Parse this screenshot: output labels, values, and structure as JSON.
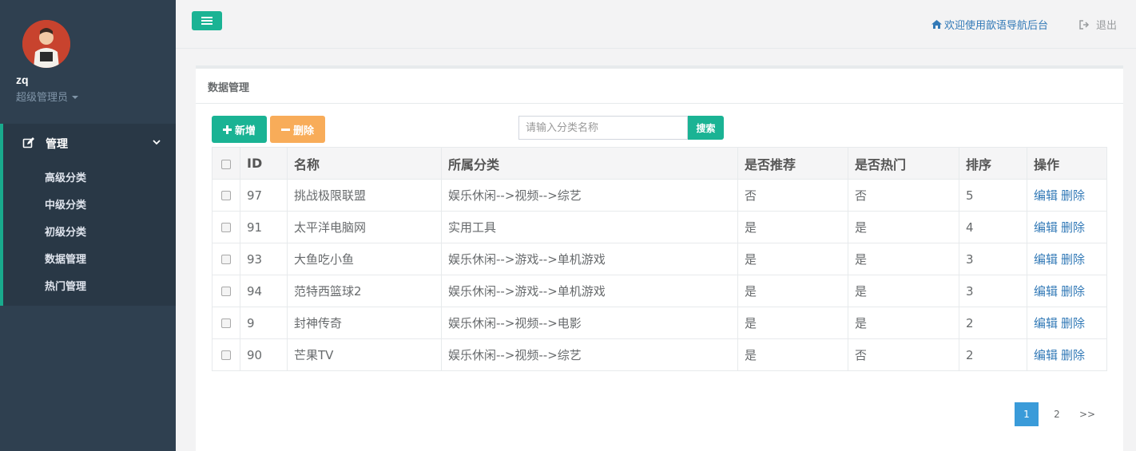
{
  "sidebar": {
    "user_name": "zq",
    "user_role": "超级管理员",
    "menu_label": "管理",
    "items": [
      "高级分类",
      "中级分类",
      "初级分类",
      "数据管理",
      "热门管理"
    ]
  },
  "header": {
    "welcome": "欢迎使用歆语导航后台",
    "logout": "退出"
  },
  "panel": {
    "title": "数据管理",
    "add_label": "新增",
    "delete_label": "删除",
    "search_placeholder": "请输入分类名称",
    "search_button": "搜索"
  },
  "table": {
    "headers": [
      "ID",
      "名称",
      "所属分类",
      "是否推荐",
      "是否热门",
      "排序",
      "操作"
    ],
    "rows": [
      {
        "id": "97",
        "name": "挑战极限联盟",
        "category": "娱乐休闲-->视频-->综艺",
        "recommend": "否",
        "hot": "否",
        "sort": "5"
      },
      {
        "id": "91",
        "name": "太平洋电脑网",
        "category": "实用工具",
        "recommend": "是",
        "hot": "是",
        "sort": "4"
      },
      {
        "id": "93",
        "name": "大鱼吃小鱼",
        "category": "娱乐休闲-->游戏-->单机游戏",
        "recommend": "是",
        "hot": "是",
        "sort": "3"
      },
      {
        "id": "94",
        "name": "范特西篮球2",
        "category": "娱乐休闲-->游戏-->单机游戏",
        "recommend": "是",
        "hot": "是",
        "sort": "3"
      },
      {
        "id": "9",
        "name": "封神传奇",
        "category": "娱乐休闲-->视频-->电影",
        "recommend": "是",
        "hot": "是",
        "sort": "2"
      },
      {
        "id": "90",
        "name": "芒果TV",
        "category": "娱乐休闲-->视频-->综艺",
        "recommend": "是",
        "hot": "否",
        "sort": "2"
      }
    ],
    "edit_label": "编辑",
    "remove_label": "删除"
  },
  "pagination": {
    "pages": [
      "1",
      "2"
    ],
    "current": "1",
    "next": ">>"
  },
  "colors": {
    "sidebar": "#2f4050",
    "accent": "#1ab394",
    "warning": "#f8ac59",
    "link": "#337ab7",
    "page_active": "#3a9bd9"
  }
}
